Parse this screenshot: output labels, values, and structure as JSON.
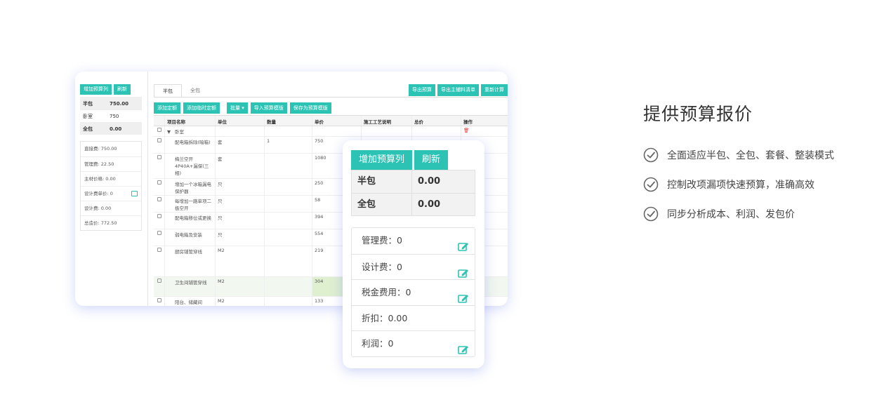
{
  "left_panel": {
    "add_column_label": "增加预算列",
    "refresh_label": "刷新",
    "summary": [
      {
        "key": "半包",
        "value": "750.00",
        "shaded": true
      },
      {
        "key": "卧室",
        "value": "750",
        "shaded": false
      },
      {
        "key": "全包",
        "value": "0.00",
        "shaded": true
      }
    ],
    "fees": [
      {
        "text": "直接费: 750.00",
        "editable": false
      },
      {
        "text": "管理费: 22.50",
        "editable": false
      },
      {
        "text": "主材价格: 0.00",
        "editable": false
      },
      {
        "text": "设计费单价: 0",
        "editable": true
      },
      {
        "text": "设计费: 0.00",
        "editable": false
      },
      {
        "text": "总造价: 772.50",
        "editable": false
      }
    ]
  },
  "right_panel": {
    "tabs": [
      "半包",
      "全包"
    ],
    "top_buttons": [
      "导出预算",
      "导出主辅料清单",
      "重新计算"
    ],
    "tool_buttons": [
      "添加定额",
      "添加临时定额",
      "批量 ▾",
      "导入预算模版",
      "保存为预算模版"
    ],
    "columns": [
      "",
      "项目名称",
      "单位",
      "数量",
      "单价",
      "施工工艺说明",
      "总价",
      "操作"
    ],
    "group_row": {
      "toggle": "▼",
      "name": "卧室"
    },
    "rows": [
      {
        "name": "配电箱拆除(暗箱)",
        "unit": "套",
        "qty": "1",
        "price": "750",
        "highlight": false
      },
      {
        "name": "梅兰空开4P40A+漏保(三相)",
        "unit": "套",
        "qty": "",
        "price": "1080",
        "highlight": false
      },
      {
        "name": "增加一个冰箱漏电保护器",
        "unit": "只",
        "qty": "",
        "price": "250",
        "highlight": false
      },
      {
        "name": "每增加一路单项二极空开",
        "unit": "只",
        "qty": "",
        "price": "58",
        "highlight": false
      },
      {
        "name": "配电箱移位或更换",
        "unit": "只",
        "qty": "",
        "price": "394",
        "highlight": false
      },
      {
        "name": "弱电箱及安装",
        "unit": "只",
        "qty": "",
        "price": "554",
        "highlight": false
      },
      {
        "name": "厨房铺管穿线",
        "unit": "M2",
        "qty": "",
        "price": "219",
        "highlight": false
      },
      {
        "name": "卫生间铺管穿线",
        "unit": "M2",
        "qty": "",
        "price": "304",
        "highlight": true
      },
      {
        "name": "阳台、储藏间",
        "unit": "M2",
        "qty": "",
        "price": "133",
        "highlight": false
      }
    ]
  },
  "popup": {
    "add_column_label": "增加预算列",
    "refresh_label": "刷新",
    "summary": [
      {
        "key": "半包",
        "value": "0.00"
      },
      {
        "key": "全包",
        "value": "0.00"
      }
    ],
    "fees": [
      {
        "text": "管理费：0",
        "editable": true
      },
      {
        "text": "设计费：0",
        "editable": true
      },
      {
        "text": "税金费用：0",
        "editable": true
      },
      {
        "text": "折扣：0.00",
        "editable": false
      },
      {
        "text": "利润：0",
        "editable": true
      }
    ]
  },
  "feature": {
    "title": "提供预算报价",
    "items": [
      "全面适应半包、全包、套餐、整装模式",
      "控制改项漏项快速预算，准确高效",
      "同步分析成本、利润、发包价"
    ]
  },
  "colors": {
    "accent": "#2cc3b5",
    "danger": "#e03a3a"
  }
}
